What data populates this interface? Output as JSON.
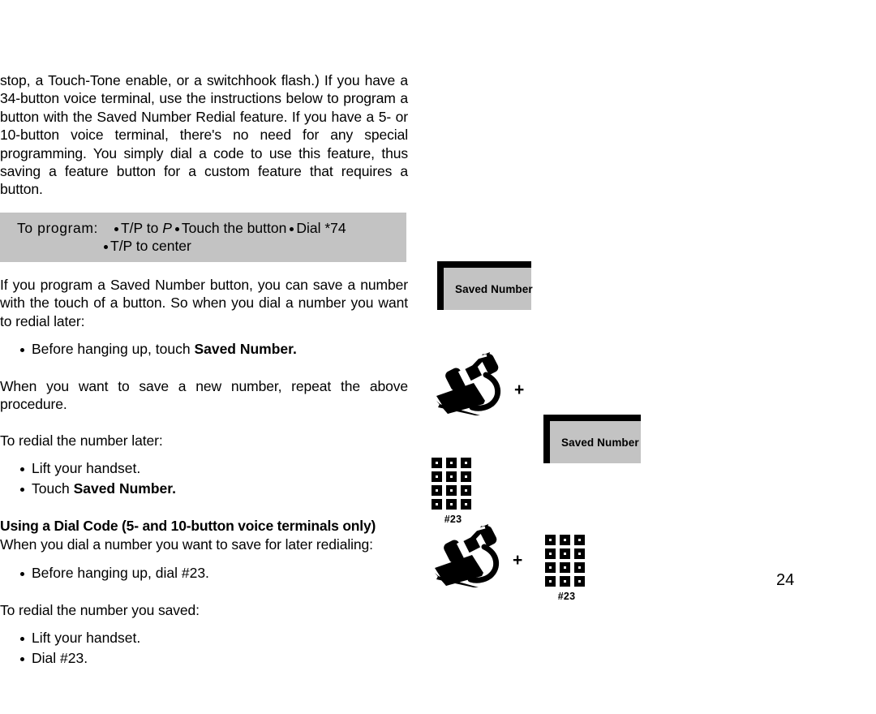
{
  "page": {
    "number": "24"
  },
  "content": {
    "intro_paragraph": "stop, a Touch-Tone enable, or a switchhook flash.) If you have a 34-button voice terminal, use the instructions below to program a button with the Saved Number Redial feature. If you have a 5- or 10-button voice terminal, there's no need for any special programming. You simply dial a code to use this feature, thus saving a feature button for a custom feature that requires a button.",
    "program_box": {
      "label": "To program:",
      "step1": "T/P to",
      "step1_italic": "P",
      "step2": "Touch the button",
      "step3": "Dial *74",
      "step4": "T/P to center"
    },
    "paragraph_2": "If you program a Saved Number button, you can save a number with the touch of a button. So when you dial a number you want to redial later:",
    "bullet_save": {
      "text": "Before hanging up, touch ",
      "bold": "Saved Number."
    },
    "paragraph_3": "When you want to save a new number, repeat the above procedure.",
    "paragraph_4": "To redial the number later:",
    "bullets_redial": {
      "lift": "Lift your handset.",
      "touch_prefix": "Touch ",
      "touch_bold": "Saved Number."
    },
    "subheading": "Using a Dial Code (5- and 10-button voice terminals only)",
    "paragraph_5": "When you dial a number you want to save for later redialing:",
    "bullet_dial_save": "Before hanging up, dial #23.",
    "paragraph_6": "To redial the number you saved:",
    "bullets_dial_redial": {
      "lift": "Lift your handset.",
      "dial": "Dial #23."
    }
  },
  "illustrations": {
    "button_top": {
      "label": "Saved Number"
    },
    "lift_and_touch": {
      "handset_icon": "lifted-handset-icon",
      "plus": "+",
      "button_label": "Saved Number"
    },
    "keypad_dial": {
      "keypad_icon": "telephone-keypad-icon",
      "code": "#23"
    },
    "lift_and_dial": {
      "handset_icon": "lifted-handset-icon",
      "plus": "+",
      "keypad_icon": "telephone-keypad-icon",
      "code": "#23"
    }
  },
  "colors": {
    "gray_band": "#c3c3c3",
    "button_face": "#c3c3c3",
    "ink": "#000000",
    "paper": "#ffffff"
  }
}
